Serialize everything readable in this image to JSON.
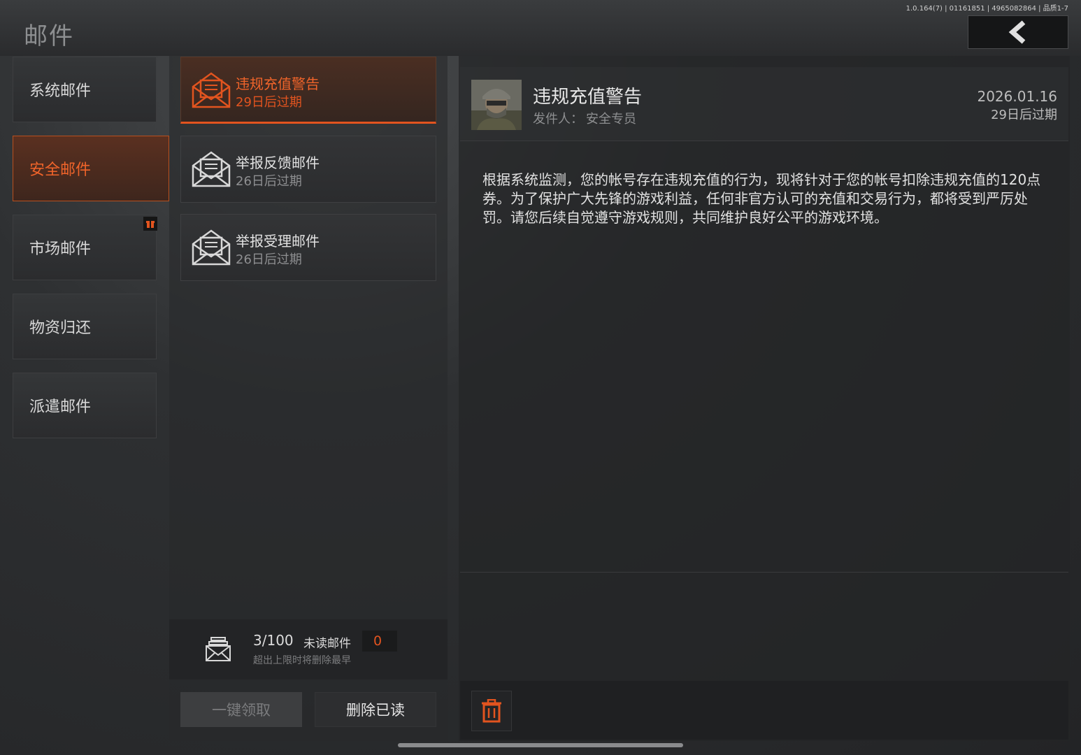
{
  "header": {
    "title": "邮件",
    "version": "1.0.164(7) | 01161851 | 4965082864 | 品质1-7"
  },
  "categories": [
    {
      "label": "系统邮件"
    },
    {
      "label": "安全邮件",
      "active": true
    },
    {
      "label": "市场邮件",
      "has_badge": true
    },
    {
      "label": "物资归还"
    },
    {
      "label": "派遣邮件"
    }
  ],
  "mails": [
    {
      "title": "违规充值警告",
      "expire": "29日后过期",
      "active": true
    },
    {
      "title": "举报反馈邮件",
      "expire": "26日后过期"
    },
    {
      "title": "举报受理邮件",
      "expire": "26日后过期"
    }
  ],
  "stats": {
    "count": "3/100",
    "unread_label": "未读邮件",
    "unread_value": "0",
    "hint": "超出上限时将删除最早"
  },
  "buttons": {
    "claim_all": "一键领取",
    "delete_read": "删除已读"
  },
  "detail": {
    "title": "违规充值警告",
    "sender_label": "发件人：",
    "sender": "安全专员",
    "date": "2026.01.16",
    "expire": "29日后过期",
    "body": "根据系统监测，您的帐号存在违规充值的行为，现将针对于您的帐号扣除违规充值的120点券。为了保护广大先锋的游戏利益，任何非官方认可的充值和交易行为，都将受到严厉处罚。请您后续自觉遵守游戏规则，共同维护良好公平的游戏环境。"
  },
  "colors": {
    "accent": "#e2541f",
    "accent_text": "#f0642a"
  },
  "icons": {
    "back": "chevron-left-icon",
    "mail": "open-envelope-icon",
    "inbox": "mail-tray-icon",
    "trash": "trash-icon",
    "badge": "gift-icon"
  }
}
